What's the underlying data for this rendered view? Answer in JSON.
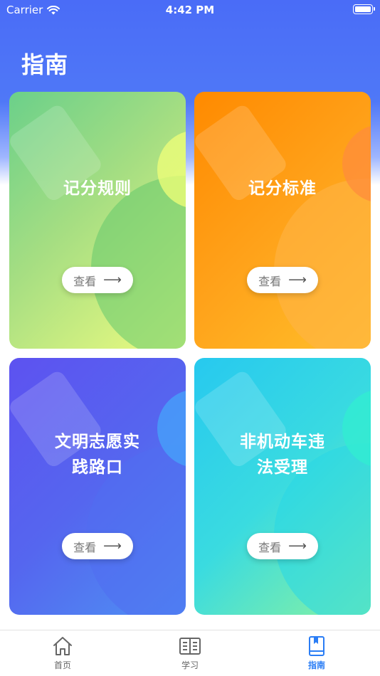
{
  "status_bar": {
    "carrier": "Carrier",
    "time": "4:42 PM"
  },
  "header": {
    "title": "指南"
  },
  "cards": [
    {
      "title_line1": "记分规则",
      "title_line2": "",
      "button_label": "查看"
    },
    {
      "title_line1": "记分标准",
      "title_line2": "",
      "button_label": "查看"
    },
    {
      "title_line1": "文明志愿实",
      "title_line2": "践路口",
      "button_label": "查看"
    },
    {
      "title_line1": "非机动车违",
      "title_line2": "法受理",
      "button_label": "查看"
    }
  ],
  "tabbar": {
    "items": [
      {
        "label": "首页",
        "icon": "home-icon",
        "active": false
      },
      {
        "label": "学习",
        "icon": "book-icon",
        "active": false
      },
      {
        "label": "指南",
        "icon": "guide-icon",
        "active": true
      }
    ]
  },
  "colors": {
    "header_blue": "#4a6cf7",
    "active_tab": "#2a7df5"
  }
}
